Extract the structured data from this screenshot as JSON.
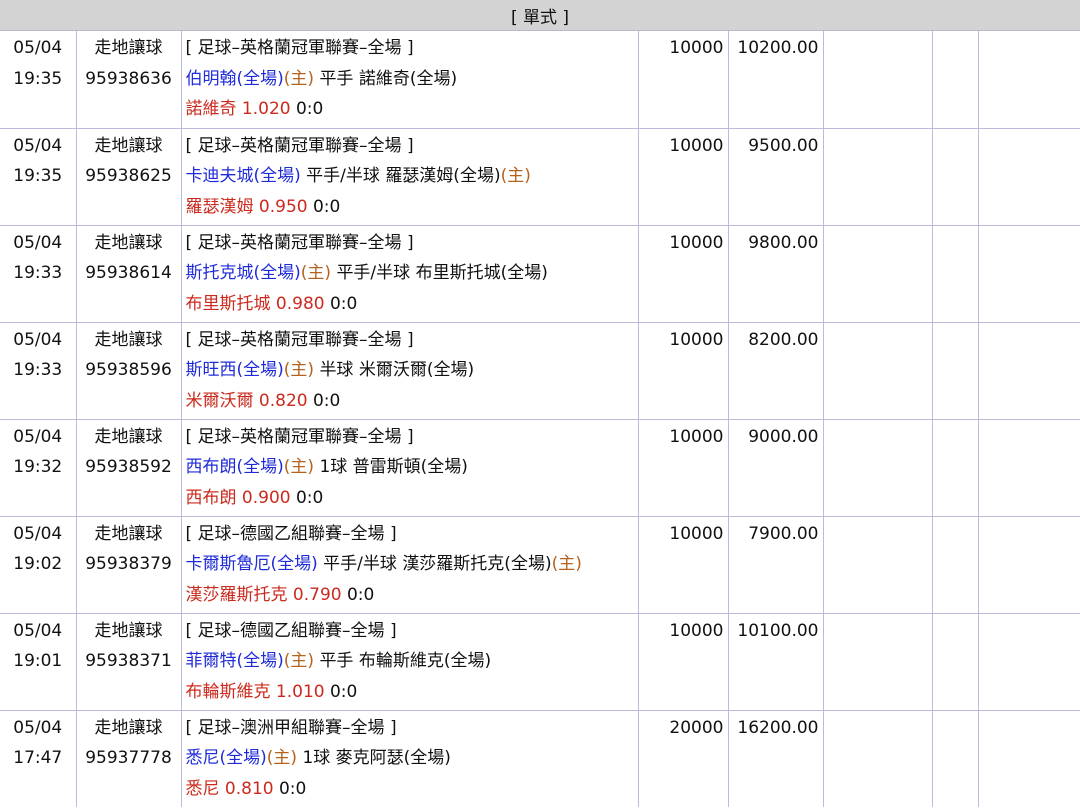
{
  "header": {
    "title": "[ 單式 ]"
  },
  "bets": [
    {
      "date": "05/04",
      "time": "19:35",
      "type": "走地讓球",
      "id": "95938636",
      "league": "[ 足球–英格蘭冠軍聯賽–全場 ]",
      "team1": "伯明翰(全場)",
      "team1_mark": "(主)",
      "handicap": "平手",
      "team2": "諾維奇(全場)",
      "team2_mark": "",
      "pick": "諾維奇",
      "odds": "1.020",
      "score": "0:0",
      "stake": "10000",
      "payout": "10200.00"
    },
    {
      "date": "05/04",
      "time": "19:35",
      "type": "走地讓球",
      "id": "95938625",
      "league": "[ 足球–英格蘭冠軍聯賽–全場 ]",
      "team1": "卡迪夫城(全場)",
      "team1_mark": "",
      "handicap": "平手/半球",
      "team2": "羅瑟漢姆(全場)",
      "team2_mark": "(主)",
      "pick": "羅瑟漢姆",
      "odds": "0.950",
      "score": "0:0",
      "stake": "10000",
      "payout": "9500.00"
    },
    {
      "date": "05/04",
      "time": "19:33",
      "type": "走地讓球",
      "id": "95938614",
      "league": "[ 足球–英格蘭冠軍聯賽–全場 ]",
      "team1": "斯托克城(全場)",
      "team1_mark": "(主)",
      "handicap": "平手/半球",
      "team2": "布里斯托城(全場)",
      "team2_mark": "",
      "pick": "布里斯托城",
      "odds": "0.980",
      "score": "0:0",
      "stake": "10000",
      "payout": "9800.00"
    },
    {
      "date": "05/04",
      "time": "19:33",
      "type": "走地讓球",
      "id": "95938596",
      "league": "[ 足球–英格蘭冠軍聯賽–全場 ]",
      "team1": "斯旺西(全場)",
      "team1_mark": "(主)",
      "handicap": "半球",
      "team2": "米爾沃爾(全場)",
      "team2_mark": "",
      "pick": "米爾沃爾",
      "odds": "0.820",
      "score": "0:0",
      "stake": "10000",
      "payout": "8200.00"
    },
    {
      "date": "05/04",
      "time": "19:32",
      "type": "走地讓球",
      "id": "95938592",
      "league": "[ 足球–英格蘭冠軍聯賽–全場 ]",
      "team1": "西布朗(全場)",
      "team1_mark": "(主)",
      "handicap": "1球",
      "team2": "普雷斯頓(全場)",
      "team2_mark": "",
      "pick": "西布朗",
      "odds": "0.900",
      "score": "0:0",
      "stake": "10000",
      "payout": "9000.00"
    },
    {
      "date": "05/04",
      "time": "19:02",
      "type": "走地讓球",
      "id": "95938379",
      "league": "[ 足球–德國乙組聯賽–全場 ]",
      "team1": "卡爾斯魯厄(全場)",
      "team1_mark": "",
      "handicap": "平手/半球",
      "team2": "漢莎羅斯托克(全場)",
      "team2_mark": "(主)",
      "pick": "漢莎羅斯托克",
      "odds": "0.790",
      "score": "0:0",
      "stake": "10000",
      "payout": "7900.00"
    },
    {
      "date": "05/04",
      "time": "19:01",
      "type": "走地讓球",
      "id": "95938371",
      "league": "[ 足球–德國乙組聯賽–全場 ]",
      "team1": "菲爾特(全場)",
      "team1_mark": "(主)",
      "handicap": "平手",
      "team2": "布輪斯維克(全場)",
      "team2_mark": "",
      "pick": "布輪斯維克",
      "odds": "1.010",
      "score": "0:0",
      "stake": "10000",
      "payout": "10100.00"
    },
    {
      "date": "05/04",
      "time": "17:47",
      "type": "走地讓球",
      "id": "95937778",
      "league": "[ 足球–澳洲甲組聯賽–全場 ]",
      "team1": "悉尼(全場)",
      "team1_mark": "(主)",
      "handicap": "1球",
      "team2": "麥克阿瑟(全場)",
      "team2_mark": "",
      "pick": "悉尼",
      "odds": "0.810",
      "score": "0:0",
      "stake": "20000",
      "payout": "16200.00"
    }
  ]
}
